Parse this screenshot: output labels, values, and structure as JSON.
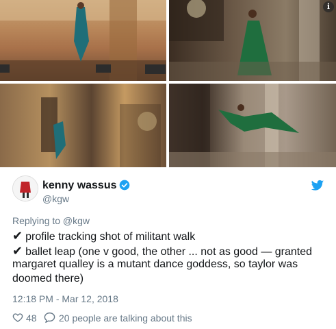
{
  "media": {
    "images": [
      "grid-photo-1",
      "grid-photo-2",
      "grid-photo-3",
      "grid-photo-4"
    ],
    "info_icon": "info-icon"
  },
  "author": {
    "name": "kenny wassus",
    "handle": "@kgw",
    "verified_icon": "verified-badge-icon",
    "avatar": "avatar"
  },
  "brand_icon": "twitter-bird-icon",
  "tweet": {
    "replying_to": "Replying to @kgw",
    "check_glyph": "✔",
    "line1": "profile tracking shot of militant walk",
    "line2": "ballet leap (one v good, the other ... not as good — granted",
    "line3": "margaret qualley is a mutant dance goddess, so taylor was",
    "line4": "doomed there)",
    "timestamp": "12:18 PM - Mar 12, 2018"
  },
  "actions": {
    "likes": "48",
    "talking": "20 people are talking about this"
  },
  "colors": {
    "accent": "#1da1f2",
    "secondary_text": "#657786",
    "primary_text": "#14171a"
  }
}
